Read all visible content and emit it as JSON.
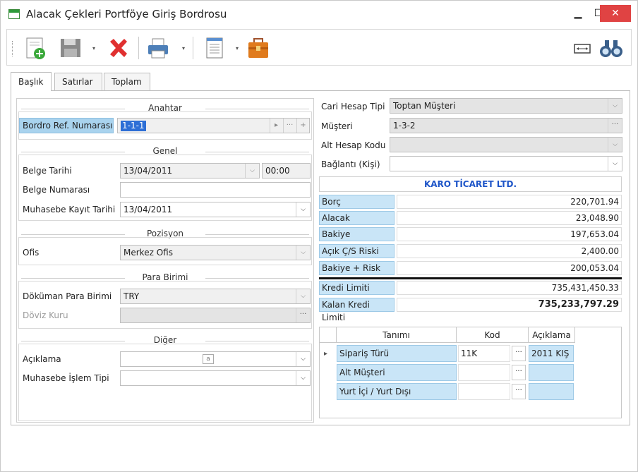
{
  "window": {
    "title": "Alacak Çekleri Portföye Giriş Bordrosu",
    "min_glyph": "▁",
    "max_glyph": "☐",
    "close_glyph": "✕"
  },
  "toolbar": {
    "items": [
      "new-document-icon",
      "save-disk-icon",
      "delete-x-icon",
      "print-icon",
      "report-page-icon",
      "briefcase-icon",
      "fit-width-icon",
      "binoculars-icon"
    ],
    "drop_glyph": "▾"
  },
  "tabs": [
    "Başlık",
    "Satırlar",
    "Toplam"
  ],
  "left": {
    "anahtar": {
      "heading": "Anahtar",
      "ref_label": "Bordro Ref. Numarası",
      "ref_value": "1-1-1",
      "btn_next": "▸",
      "btn_more": "···",
      "btn_add": "+"
    },
    "genel": {
      "heading": "Genel",
      "belge_tarihi_label": "Belge Tarihi",
      "belge_tarihi_value": "13/04/2011",
      "belge_saat_value": "00:00",
      "belge_numarasi_label": "Belge Numarası",
      "belge_numarasi_value": "",
      "muhasebe_tarihi_label": "Muhasebe Kayıt Tarihi",
      "muhasebe_tarihi_value": "13/04/2011"
    },
    "pozisyon": {
      "heading": "Pozisyon",
      "ofis_label": "Ofis",
      "ofis_value": "Merkez Ofis"
    },
    "para_birimi": {
      "heading": "Para Birimi",
      "doc_currency_label": "Döküman Para Birimi",
      "doc_currency_value": "TRY",
      "rate_label": "Döviz Kuru",
      "rate_value": ""
    },
    "diger": {
      "heading": "Diğer",
      "aciklama_label": "Açıklama",
      "aciklama_value": "",
      "islem_label": "Muhasebe İşlem Tipi",
      "islem_value": ""
    }
  },
  "right": {
    "cari_tip_label": "Cari Hesap Tipi",
    "cari_tip_value": "Toptan Müşteri",
    "musteri_label": "Müşteri",
    "musteri_value": "1-3-2",
    "alt_hesap_label": "Alt Hesap Kodu",
    "alt_hesap_value": "",
    "baglanti_label": "Bağlantı (Kişi)",
    "baglanti_value": "",
    "company": "KARO TİCARET LTD.",
    "summary": [
      {
        "label": "Borç",
        "value": "220,701.94"
      },
      {
        "label": "Alacak",
        "value": "23,048.90"
      },
      {
        "label": "Bakiye",
        "value": "197,653.04"
      },
      {
        "label": "Açık Ç/S Riski",
        "value": "2,400.00"
      },
      {
        "label": "Bakiye + Risk",
        "value": "200,053.04"
      }
    ],
    "credit": [
      {
        "label": "Kredi Limiti",
        "value": "735,431,450.33"
      },
      {
        "label": "Kalan Kredi Limiti",
        "value": "735,233,797.29"
      }
    ],
    "grid": {
      "headers": [
        "Tanımı",
        "Kod",
        "Açıklama"
      ],
      "rows": [
        {
          "tanim": "Sipariş Türü",
          "kod": "11K",
          "aciklama": "2011 KIŞ"
        },
        {
          "tanim": "Alt Müşteri",
          "kod": "",
          "aciklama": ""
        },
        {
          "tanim": "Yurt İçi / Yurt Dışı",
          "kod": "",
          "aciklama": ""
        }
      ],
      "row_marker": "▸",
      "btn": "···"
    }
  }
}
